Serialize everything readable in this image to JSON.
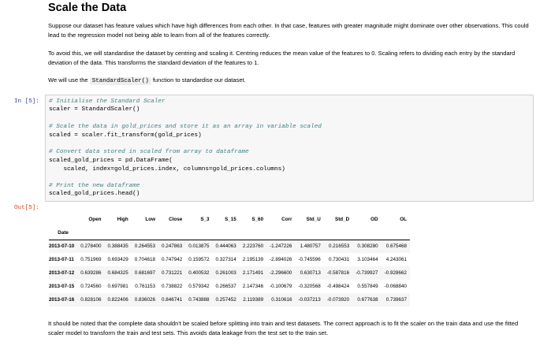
{
  "heading": "Scale the Data",
  "paragraphs": {
    "p1": "Suppose our dataset has feature values which have high differences from each other. In that case, features with greater magnitude might dominate over other observations. This could lead to the regression model not being able to learn from all of the features correctly.",
    "p2": "To avoid this, we will standardise the dataset by centring and scaling it. Centring reduces the mean value of the features to 0. Scaling refers to dividing each entry by the standard deviation of the data. This transforms the standard deviation of the features to 1.",
    "p3_before": "We will use the ",
    "p3_code": "StandardScaler()",
    "p3_after": " function to standardise our dataset.",
    "last": "It should be noted that the complete data shouldn't be scaled before splitting into train and test datasets. The correct approach is to fit the scaler on the train data and use the fitted scaler model to transform the train and test sets. This avoids data leakage from the test set to the train set."
  },
  "prompts": {
    "in": "In [5]:",
    "out": "Out[5]:"
  },
  "code_lines": [
    {
      "text": "# Initialise the Standard Scaler",
      "comment": true
    },
    {
      "text": "scaler = StandardScaler()",
      "comment": false
    },
    {
      "text": "# Scale the data in gold_prices and store it as an array in variable scaled",
      "comment": true
    },
    {
      "text": "scaled = scaler.fit_transform(gold_prices)",
      "comment": false
    },
    {
      "text": "# Convert data stored in scaled from array to dataframe",
      "comment": true
    },
    {
      "text": "scaled_gold_prices = pd.DataFrame(",
      "comment": false
    },
    {
      "text": "    scaled, index=gold_prices.index, columns=gold_prices.columns)",
      "comment": false
    },
    {
      "text": "# Print the new dataframe",
      "comment": true
    },
    {
      "text": "scaled_gold_prices.head()",
      "comment": false
    }
  ],
  "table": {
    "columns": [
      "Open",
      "High",
      "Low",
      "Close",
      "S_3",
      "S_15",
      "S_60",
      "Corr",
      "Std_U",
      "Std_D",
      "OD",
      "OL"
    ],
    "index_name": "Date",
    "rows": [
      {
        "date": "2013-07-10",
        "values": [
          "0.278400",
          "0.388435",
          "0.264553",
          "0.247863",
          "0.013875",
          "0.444063",
          "2.223760",
          "-1.247226",
          "1.480757",
          "0.216553",
          "0.308280",
          "0.675468"
        ]
      },
      {
        "date": "2013-07-11",
        "values": [
          "0.751969",
          "0.693429",
          "0.704618",
          "0.747942",
          "0.159572",
          "0.327314",
          "2.195139",
          "-2.894026",
          "-0.745596",
          "0.730431",
          "3.103464",
          "4.243061"
        ]
      },
      {
        "date": "2013-07-12",
        "values": [
          "0.639286",
          "0.684325",
          "0.681697",
          "0.731221",
          "0.400532",
          "0.261003",
          "2.171491",
          "-2.296600",
          "0.630713",
          "-0.587816",
          "-0.739927",
          "-0.928662"
        ]
      },
      {
        "date": "2013-07-15",
        "values": [
          "0.724560",
          "0.697981",
          "0.761153",
          "0.738822",
          "0.579342",
          "0.266537",
          "2.147346",
          "-0.100679",
          "-0.320568",
          "-0.498424",
          "0.557849",
          "-0.068840"
        ]
      },
      {
        "date": "2013-07-16",
        "values": [
          "0.828106",
          "0.822406",
          "0.836026",
          "0.846741",
          "0.743888",
          "0.257452",
          "2.119389",
          "0.310616",
          "-0.037213",
          "-0.073920",
          "0.677638",
          "0.739637"
        ]
      }
    ]
  }
}
